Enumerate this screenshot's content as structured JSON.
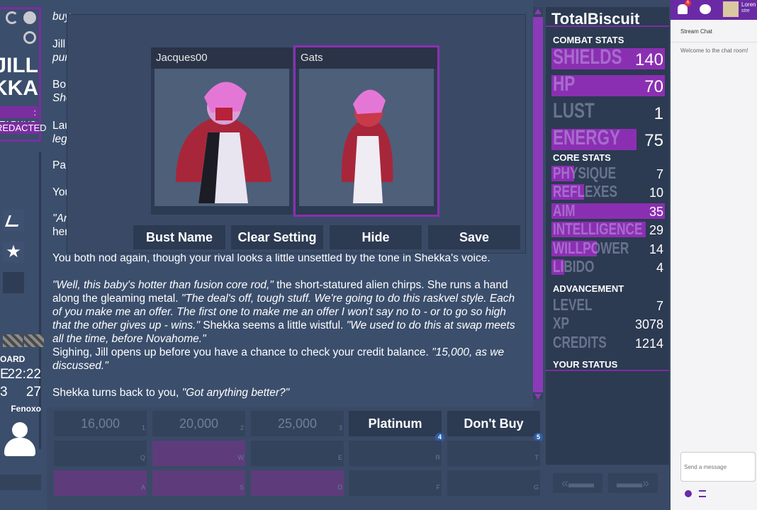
{
  "sidebar": {
    "name_line1": "JILL",
    "name_line2": "EKKA",
    "tag1": ": TARKUS",
    "tag2": "REDACTED",
    "board_label": "OARD",
    "time_value": "22:22",
    "time_prefix": "E",
    "count_value": "27",
    "count_prefix": "3",
    "author": "Fenoxo"
  },
  "story": {
    "p1": "buy",
    "p2a": "Jill",
    "p2b": "pur",
    "p3a": "Bo",
    "p3b": "She",
    "p4a": "Lau",
    "p4b": "leg",
    "p5": "Pau",
    "p6": "You",
    "p7a": "\"Ar",
    "p7b": "her",
    "p8": "You both nod again, though your rival looks a little unsettled by the tone in Shekka's voice.",
    "p9_q1": "\"Well, this baby's hotter than fusion core rod,\"",
    "p9_t1": " the short-statured alien chirps. She runs a hand along the gleaming metal. ",
    "p9_q2": "\"The deal's off, tough stuff. We're going to do this raskvel style. Each of you make me an offer. The first one to make me an offer I won't say no to - or to go so high that the other gives up - wins.\"",
    "p9_t2": " Shekka seems a little wistful. ",
    "p9_q3": "\"We used to do this at swap meets all the time, before Novahome.\"",
    "p10_t": "Sighing, Jill opens up before you have a chance to check your credit balance. ",
    "p10_q": "\"15,000, as we discussed.\"",
    "p11_t": "Shekka turns back to you, ",
    "p11_q": "\"Got anything better?\""
  },
  "modal": {
    "tile1_name": "Jacques00",
    "tile2_name": "Gats",
    "buttons": [
      "Bust Name",
      "Clear Setting",
      "Hide",
      "Save"
    ]
  },
  "buttons": {
    "row1": [
      {
        "label": "16,000",
        "num": "1"
      },
      {
        "label": "20,000",
        "num": "2"
      },
      {
        "label": "25,000",
        "num": "3"
      },
      {
        "label": "Platinum",
        "num": "4"
      },
      {
        "label": "Don't Buy",
        "num": "5"
      }
    ],
    "row2_nums": [
      "Q",
      "W",
      "E",
      "R",
      "T"
    ],
    "row3_nums": [
      "A",
      "S",
      "D",
      "F",
      "G"
    ]
  },
  "stats": {
    "player": "TotalBiscuit",
    "combat_header": "COMBAT STATS",
    "combat": [
      {
        "label": "SHIELDS",
        "value": "140",
        "fill": 1.0
      },
      {
        "label": "HP",
        "value": "70",
        "fill": 1.0
      },
      {
        "label": "LUST",
        "value": "1",
        "fill": 0.0
      },
      {
        "label": "ENERGY",
        "value": "75",
        "fill": 0.75
      }
    ],
    "core_header": "CORE STATS",
    "core": [
      {
        "label": "PHYSIQUE",
        "value": "7",
        "fill": 0.2
      },
      {
        "label": "REFLEXES",
        "value": "10",
        "fill": 0.29
      },
      {
        "label": "AIM",
        "value": "35",
        "fill": 1.0
      },
      {
        "label": "INTELLIGENCE",
        "value": "29",
        "fill": 0.83
      },
      {
        "label": "WILLPOWER",
        "value": "14",
        "fill": 0.4
      },
      {
        "label": "LIBIDO",
        "value": "4",
        "fill": 0.11
      }
    ],
    "adv_header": "ADVANCEMENT",
    "advancement": [
      {
        "label": "LEVEL",
        "value": "7"
      },
      {
        "label": "XP",
        "value": "3078"
      },
      {
        "label": "CREDITS",
        "value": "1214"
      }
    ],
    "status_header": "YOUR STATUS"
  },
  "chat": {
    "title": "Stream Chat",
    "welcome": "Welcome to the chat room!",
    "placeholder": "Send a message",
    "user_name": "Loren",
    "user_sub": "stre",
    "notif_count": "6"
  },
  "colors": {
    "accent": "#7a2ea0",
    "bar_fill": "#8b2fb2",
    "panel": "#2c3a52",
    "background": "#3a4a66"
  }
}
